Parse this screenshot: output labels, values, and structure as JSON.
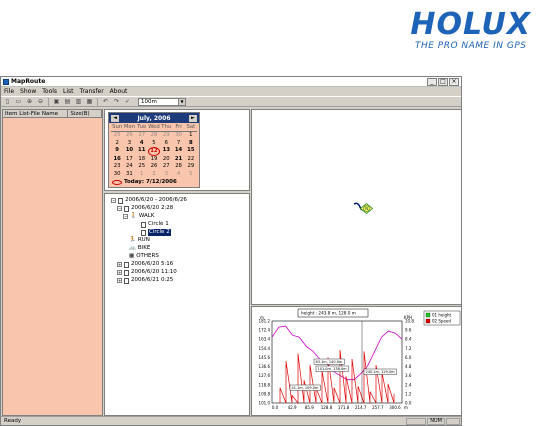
{
  "brand": {
    "logo": "HOLUX",
    "tagline": "THE PRO NAME IN GPS"
  },
  "window": {
    "title": "MapRoute",
    "buttons": {
      "minimize": "_",
      "maximize": "□",
      "close": "×"
    }
  },
  "menu": [
    "File",
    "Show",
    "Tools",
    "List",
    "Transfer",
    "About"
  ],
  "toolbar": {
    "scale": "100m"
  },
  "left_panel": {
    "col1": "Item List-File Name",
    "col2": "Size(B)"
  },
  "calendar": {
    "title": "July, 2006",
    "prev": "◄",
    "next": "►",
    "dow": [
      "Sun",
      "Mon",
      "Tue",
      "Wed",
      "Thu",
      "Fri",
      "Sat"
    ],
    "weeks": [
      [
        "25",
        "26",
        "27",
        "28",
        "29",
        "30",
        "1"
      ],
      [
        "2",
        "3",
        "4",
        "5",
        "6",
        "7",
        "8"
      ],
      [
        "9",
        "10",
        "11",
        "12",
        "13",
        "14",
        "15"
      ],
      [
        "16",
        "17",
        "18",
        "19",
        "20",
        "21",
        "22"
      ],
      [
        "23",
        "24",
        "25",
        "26",
        "27",
        "28",
        "29"
      ],
      [
        "30",
        "31",
        "1",
        "2",
        "3",
        "4",
        "5"
      ]
    ],
    "today_label": "Today: 7/12/2006"
  },
  "tree": {
    "root": "2006/6/20 - 2006/6/26",
    "day1": "2006/6/20  2:28",
    "walk": "WALK",
    "circle1": "Circle 1",
    "circle2": "Circle 2",
    "run": "RUN",
    "bike": "BIKE",
    "others": "OTHERS",
    "day2": "2006/6/20  5:16",
    "day3": "2006/6/20  11:10",
    "day4": "2006/6/21  0:25"
  },
  "map": {
    "compass_label": "N"
  },
  "chart_data": {
    "type": "line",
    "x": [
      0.0,
      42.9,
      85.9,
      128.8,
      171.8,
      214.7,
      257.7,
      300.6
    ],
    "xlabel": "m",
    "ylabel": "m",
    "y2label": "KPH",
    "ylim": [
      101.0,
      182.0
    ],
    "yticks": [
      "101.0",
      "109.8",
      "118.8",
      "127.6",
      "136.6",
      "145.6",
      "154.4",
      "163.4",
      "172.4",
      "181.2"
    ],
    "y2lim": [
      0.0,
      10.8
    ],
    "y2ticks": [
      "0.0",
      "1.2",
      "2.4",
      "3.6",
      "4.8",
      "6.0",
      "7.2",
      "8.4",
      "9.6",
      "10.8"
    ],
    "series": [
      {
        "name": "01 height",
        "color": "#cc00cc",
        "values": [
          166,
          176,
          177,
          168,
          166,
          157,
          152,
          144,
          140,
          132,
          128,
          124,
          124,
          130,
          138,
          152,
          166,
          172,
          170,
          164
        ]
      },
      {
        "name": "02 Speed",
        "color": "#e00000",
        "values": [
          2.0,
          5.5,
          1.0,
          6.5,
          3.0,
          5.0,
          2.0,
          4.2,
          6.0,
          2.0,
          7.0,
          3.5,
          5.8,
          2.2,
          6.8,
          1.5,
          5.0,
          4.0,
          2.5,
          1.2
        ]
      }
    ],
    "annotations": {
      "tooltip": "height : 243.8 m, 128.0 m",
      "labels": [
        "63.1m, 140.0m",
        "101.0m, 138.0m",
        "41.1m, 109.0m",
        "240.1m, 129.0m"
      ]
    },
    "legend": [
      "01 height",
      "02 Speed"
    ],
    "grid": false,
    "legend_position": "top-right"
  },
  "status": {
    "text": "Ready",
    "num": "NUM"
  }
}
